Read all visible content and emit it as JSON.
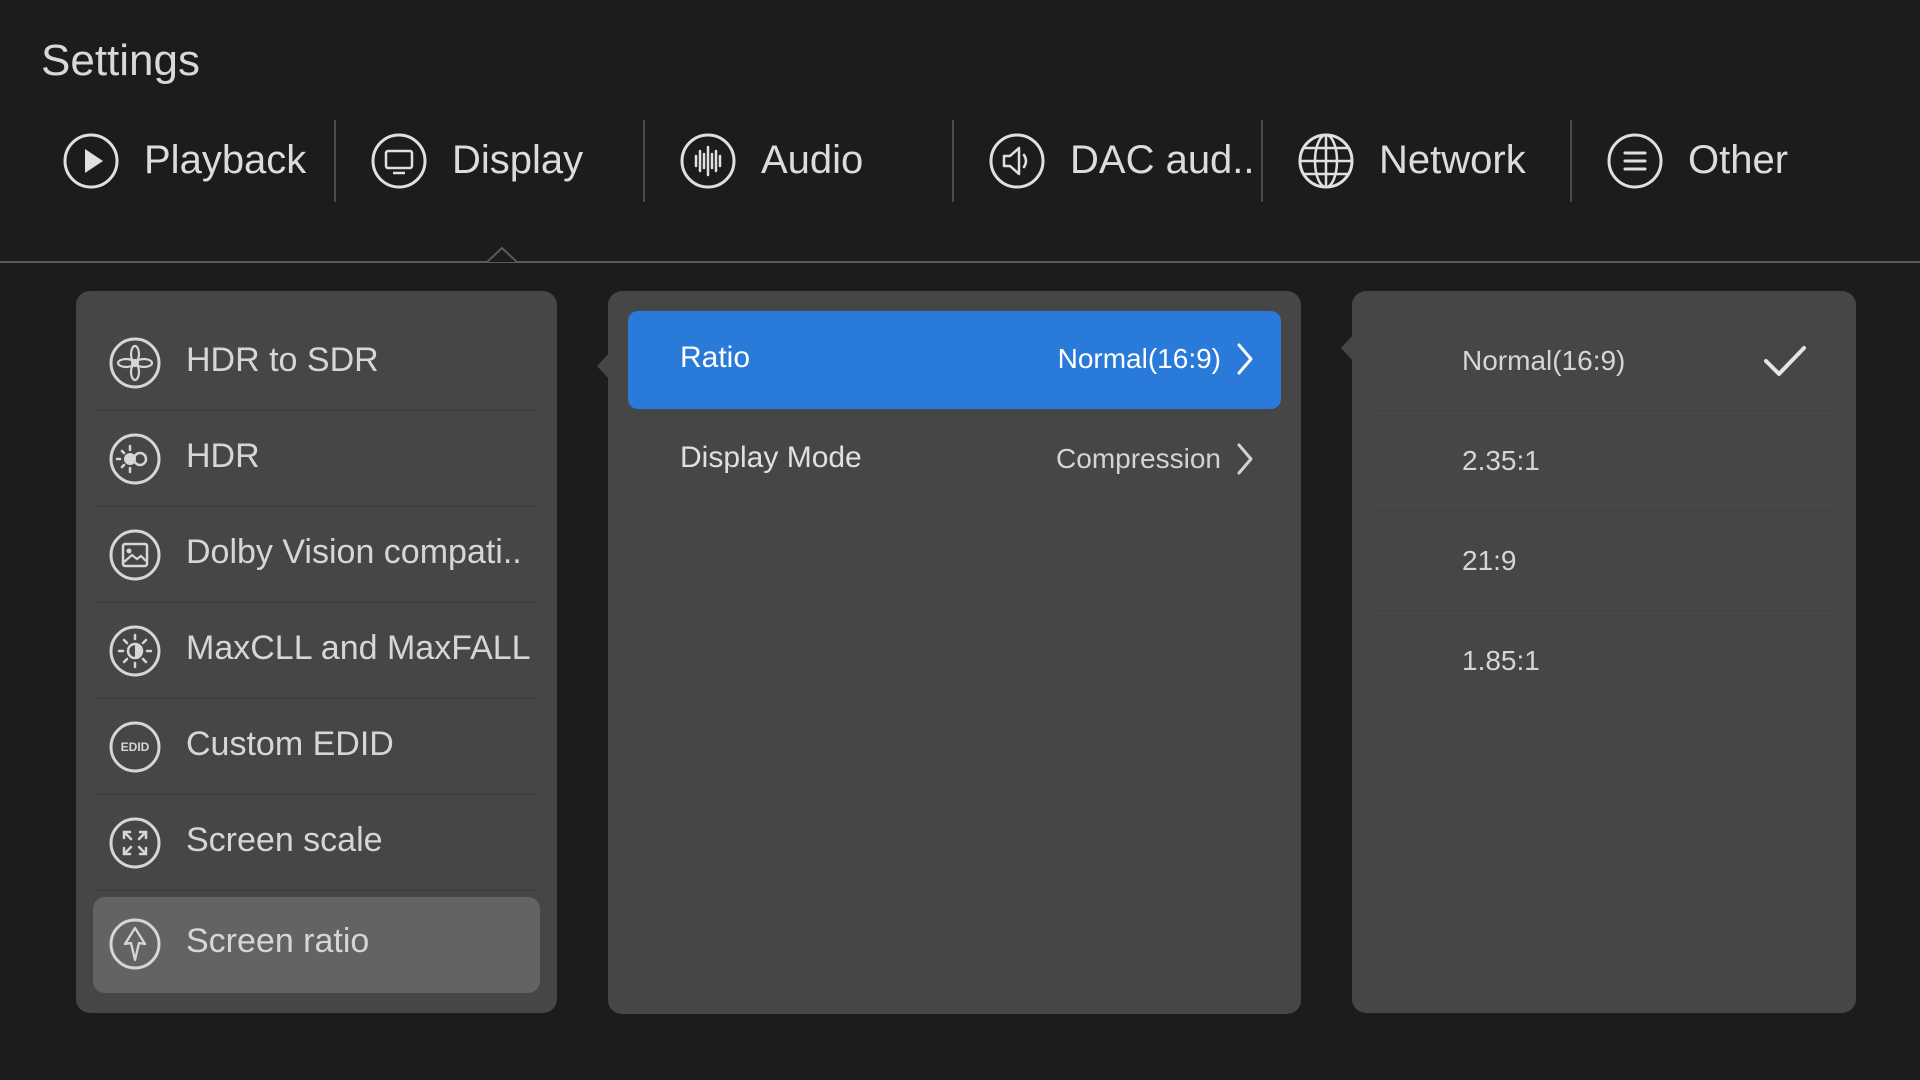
{
  "page": {
    "title": "Settings"
  },
  "tabs": [
    {
      "label": "Playback",
      "icon": "play-icon"
    },
    {
      "label": "Display",
      "icon": "monitor-icon"
    },
    {
      "label": "Audio",
      "icon": "audio-wave-icon"
    },
    {
      "label": "DAC aud..",
      "icon": "speaker-icon"
    },
    {
      "label": "Network",
      "icon": "globe-icon"
    },
    {
      "label": "Other",
      "icon": "menu-icon"
    }
  ],
  "active_tab": "Display",
  "display_menu": [
    {
      "label": "HDR to SDR",
      "icon": "hdr-to-sdr-icon"
    },
    {
      "label": "HDR",
      "icon": "hdr-icon"
    },
    {
      "label": "Dolby Vision compati..",
      "icon": "image-icon"
    },
    {
      "label": "MaxCLL and MaxFALL",
      "icon": "brightness-icon"
    },
    {
      "label": "Custom EDID",
      "icon": "edid-icon",
      "icon_text": "EDID"
    },
    {
      "label": "Screen scale",
      "icon": "expand-icon"
    },
    {
      "label": "Screen ratio",
      "icon": "ratio-icon"
    }
  ],
  "active_menu_item": "Screen ratio",
  "options": [
    {
      "label": "Ratio",
      "value": "Normal(16:9)"
    },
    {
      "label": "Display Mode",
      "value": "Compression"
    }
  ],
  "ratio_choices": [
    {
      "label": "Normal(16:9)",
      "checked": true
    },
    {
      "label": "2.35:1",
      "checked": false
    },
    {
      "label": "21:9",
      "checked": false
    },
    {
      "label": "1.85:1",
      "checked": false
    }
  ],
  "colors": {
    "background": "#1c1c1c",
    "panel": "#464646",
    "accent": "#2a7ad9",
    "active_item": "#636363"
  }
}
